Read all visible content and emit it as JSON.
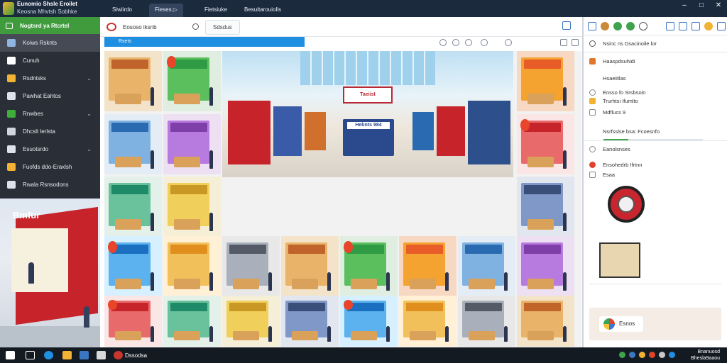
{
  "window": {
    "title": "Eunomio Shsle Eroilet",
    "subtitle": "Keosna Mhvtsh Sobhke",
    "tabs": [
      "Siwiirdo",
      "Fieses",
      "Fietsiuke",
      "Besuitarouiolis"
    ]
  },
  "sidebar": {
    "header": "Nogtsrd ya Rtcrtel",
    "items": [
      {
        "label": "Koiws Rsknts",
        "icon": "store-icon",
        "color": "#8fb6e0",
        "chevron": false,
        "active": true
      },
      {
        "label": "Cunuh",
        "icon": "diamond-icon",
        "color": "#ffffff",
        "chevron": false
      },
      {
        "label": "Rsdntsks",
        "icon": "tag-icon",
        "color": "#f2b233",
        "chevron": true
      },
      {
        "label": "Pawhat Eahtos",
        "icon": "gear-icon",
        "color": "#dde3ea",
        "chevron": false
      },
      {
        "label": "Rnwbes",
        "icon": "cash-icon",
        "color": "#3fae3a",
        "chevron": true
      },
      {
        "label": "Dhcslt lerlsta",
        "icon": "chart-icon",
        "color": "#cfd6de",
        "chevron": false
      },
      {
        "label": "Esuotsrdo",
        "icon": "location-icon",
        "color": "#dde3ea",
        "chevron": true
      },
      {
        "label": "Fuofds ddo-Eraxlsh",
        "icon": "cart-icon",
        "color": "#f2b233",
        "chevron": false
      },
      {
        "label": "Rwala Rsnsodons",
        "icon": "settings-icon",
        "color": "#dde3ea",
        "chevron": false
      }
    ]
  },
  "browser": {
    "site_label": "Eososo iksnb",
    "tab_label": "Sdsdus",
    "address": "Rsets"
  },
  "left_scene": {
    "store_sign": "Bmfur"
  },
  "mall": {
    "center_sign": "Taeiist",
    "kiosk_sign": "Hebnts 984"
  },
  "right_panel": {
    "search_text": "Nsinc ns Dsacinoile lor",
    "section1_title": "Haaspdsuhidi",
    "section1_sub": "Hsaeiitlas",
    "item1": "Ensso fo Srsbsoin",
    "item1b": "Trurhtsi Ifumlto",
    "item2": "Mdflucs 9",
    "progress_percent": 25,
    "item3": "Nsrfsslse bsa: Fcoesnfo",
    "section2_title": "Eanolsnses",
    "item4": "Ensohedrb Ifrtnn",
    "item5": "Esaa",
    "footer_button": "Esnos"
  },
  "taskbar": {
    "active_label": "Dssodsa",
    "time": "Bnanuosd",
    "date": "Bhesla9aaou"
  },
  "colors": {
    "accent_green": "#3f9b3c",
    "accent_blue": "#1f8fe2",
    "title_bg": "#1c2a3e"
  }
}
